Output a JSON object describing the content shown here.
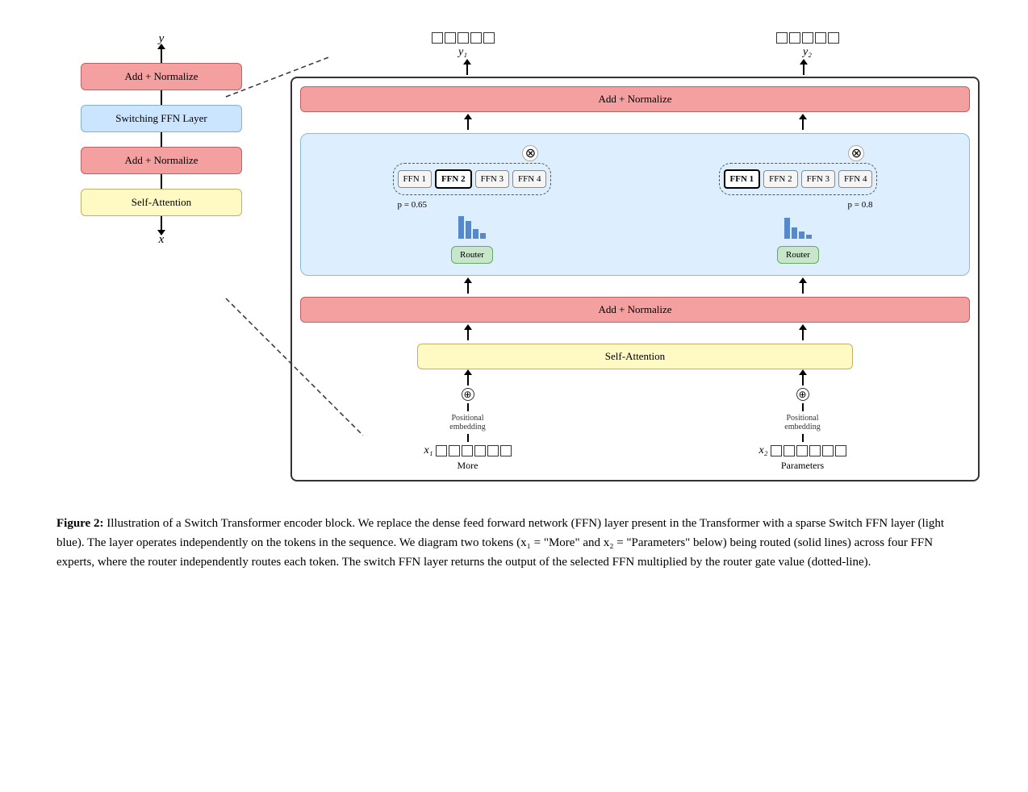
{
  "left_diagram": {
    "y_label": "y",
    "x_label": "x",
    "add_normalize_top": "Add + Normalize",
    "switching_ffn": "Switching FFN Layer",
    "add_normalize_bottom": "Add + Normalize",
    "self_attention": "Self-Attention"
  },
  "right_diagram": {
    "outputs": [
      {
        "label": "y₁"
      },
      {
        "label": "y₂"
      }
    ],
    "add_normalize_top": "Add + Normalize",
    "ffn_groups": [
      {
        "boxes": [
          "FFN 1",
          "FFN 2",
          "FFN 3",
          "FFN 4"
        ],
        "bold_idx": 1,
        "p_label": "p = 0.65",
        "router_label": "Router"
      },
      {
        "boxes": [
          "FFN 1",
          "FFN 2",
          "FFN 3",
          "FFN 4"
        ],
        "bold_idx": 0,
        "p_label": "p = 0.8",
        "router_label": "Router"
      }
    ],
    "add_normalize_mid": "Add + Normalize",
    "self_attention": "Self-Attention",
    "inputs": [
      {
        "label": "x₁",
        "sublabel": "More"
      },
      {
        "label": "x₂",
        "sublabel": "Parameters"
      }
    ],
    "positional_embedding": "Positional\nembedding"
  },
  "caption": {
    "figure_label": "Figure 2:",
    "text": "Illustration of a Switch Transformer encoder block. We replace the dense feed forward network (FFN) layer present in the Transformer with a sparse Switch FFN layer (light blue). The layer operates independently on the tokens in the sequence. We diagram two tokens (x₁ = \"More\" and x₂ = \"Parameters\" below) being routed (solid lines) across four FFN experts, where the router independently routes each token. The switch FFN layer returns the output of the selected FFN multiplied by the router gate value (dotted-line)."
  },
  "colors": {
    "add_normalize_bg": "#f4a0a0",
    "add_normalize_border": "#c06060",
    "switching_bg": "#cce5ff",
    "switching_border": "#80b0e0",
    "self_attn_bg": "#fff9c4",
    "self_attn_border": "#c0b060",
    "switch_ffn_bg": "#ddeeff",
    "switch_ffn_border": "#88bbdd",
    "router_bg": "#c8e6c9",
    "router_border": "#66aa66",
    "bar_color": "#5588cc"
  }
}
